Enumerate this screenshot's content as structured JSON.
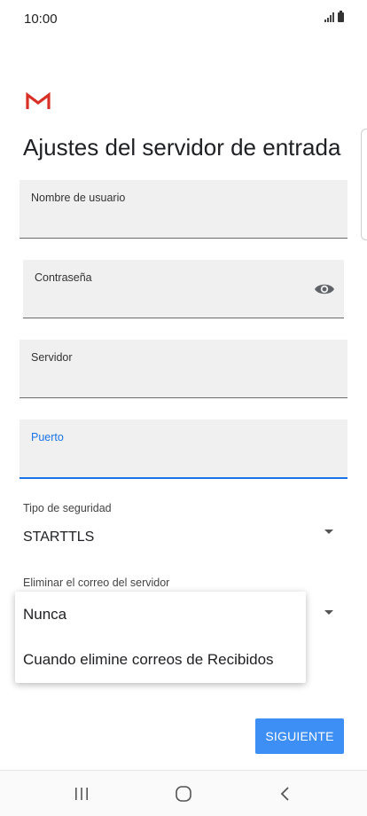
{
  "status_bar": {
    "time": "10:00"
  },
  "header": {
    "title": "Ajustes del servidor de entrada"
  },
  "form": {
    "username": {
      "label": "Nombre de usuario",
      "value": ""
    },
    "password": {
      "label": "Contraseña",
      "value": ""
    },
    "server": {
      "label": "Servidor",
      "value": ""
    },
    "port": {
      "label": "Puerto",
      "value": ""
    },
    "security": {
      "label": "Tipo de seguridad",
      "value": "STARTTLS"
    },
    "delete_from_server": {
      "label": "Eliminar el correo del servidor"
    }
  },
  "dropdown": {
    "options": [
      "Nunca",
      "Cuando elimine correos de Recibidos"
    ]
  },
  "actions": {
    "next_label": "SIGUIENTE"
  },
  "colors": {
    "accent": "#1a73e8",
    "button": "#3d8ef5",
    "field_bg": "#f0f0f0",
    "gmail_red": "#d93025"
  },
  "icons": {
    "logo": "gmail-logo",
    "password_toggle": "eye-icon",
    "nav": [
      "recent-apps-icon",
      "home-icon",
      "back-icon"
    ]
  }
}
